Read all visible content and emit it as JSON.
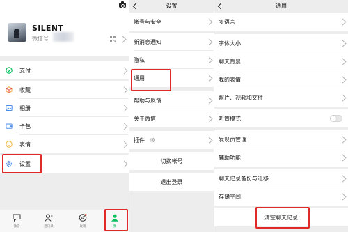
{
  "me_panel": {
    "profile": {
      "name": "SILENT",
      "wechat_id_label": "微信号"
    },
    "menu": [
      {
        "label": "支付",
        "icon": "pay-icon"
      },
      {
        "label": "收藏",
        "icon": "favorites-icon"
      },
      {
        "label": "相册",
        "icon": "album-icon"
      },
      {
        "label": "卡包",
        "icon": "card-icon"
      },
      {
        "label": "表情",
        "icon": "sticker-icon"
      },
      {
        "label": "设置",
        "icon": "settings-icon"
      }
    ],
    "tabs": [
      {
        "label": "微信",
        "icon": "chats-icon"
      },
      {
        "label": "通讯录",
        "icon": "contacts-icon"
      },
      {
        "label": "发现",
        "icon": "discover-icon"
      },
      {
        "label": "我",
        "icon": "me-icon"
      }
    ]
  },
  "settings_panel": {
    "title": "设置",
    "items": [
      "帐号与安全",
      "新消息通知",
      "隐私",
      "通用",
      "帮助与反馈",
      "关于微信",
      "插件"
    ],
    "switch_account": "切换帐号",
    "logout": "退出登录"
  },
  "general_panel": {
    "title": "通用",
    "items": [
      "多语言",
      "字体大小",
      "聊天背景",
      "我的表情",
      "照片、视频和文件",
      "听筒模式",
      "发现页管理",
      "辅助功能",
      "聊天记录备份与迁移",
      "存储空间"
    ],
    "clear_chat": "清空聊天记录"
  },
  "colors": {
    "highlight": "#e02a2a",
    "wechat_green": "#07c160",
    "background": "#ededed"
  }
}
